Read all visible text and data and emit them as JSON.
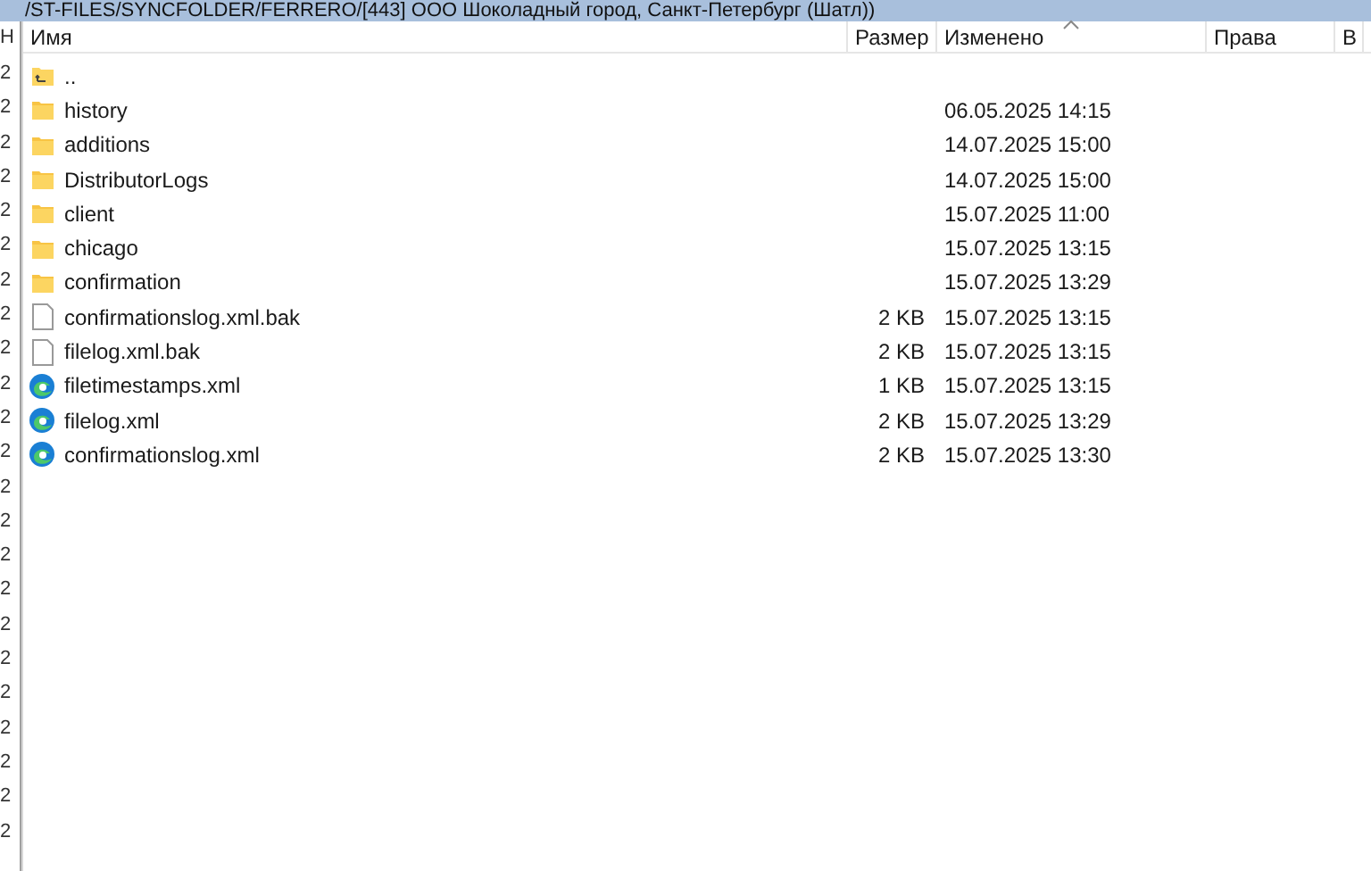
{
  "path_bar": {
    "title": "/ST-FILES/SYNCFOLDER/FERRERO/[443] ООО Шоколадный город, Санкт-Петербург (Шатл))"
  },
  "left_pane": {
    "header": "Н",
    "rows": [
      "2",
      "2",
      "2",
      "2",
      "2",
      "2",
      "2",
      "2",
      "2",
      "2",
      "2",
      "2",
      "2",
      "2",
      "2",
      "2",
      "2",
      "2",
      "2",
      "2",
      "2",
      "2",
      "2"
    ]
  },
  "table": {
    "columns": [
      {
        "label": "Имя",
        "sorted": false
      },
      {
        "label": "Размер",
        "sorted": false
      },
      {
        "label": "Изменено",
        "sorted": true
      },
      {
        "label": "Права",
        "sorted": false
      },
      {
        "label": "В",
        "sorted": false
      }
    ],
    "rows": [
      {
        "kind": "parent",
        "name": "..",
        "size": "",
        "modified": ""
      },
      {
        "kind": "folder",
        "name": "history",
        "size": "",
        "modified": "06.05.2025 14:15"
      },
      {
        "kind": "folder",
        "name": "additions",
        "size": "",
        "modified": "14.07.2025 15:00"
      },
      {
        "kind": "folder",
        "name": "DistributorLogs",
        "size": "",
        "modified": "14.07.2025 15:00"
      },
      {
        "kind": "folder",
        "name": "client",
        "size": "",
        "modified": "15.07.2025 11:00"
      },
      {
        "kind": "folder",
        "name": "chicago",
        "size": "",
        "modified": "15.07.2025 13:15"
      },
      {
        "kind": "folder",
        "name": "confirmation",
        "size": "",
        "modified": "15.07.2025 13:29"
      },
      {
        "kind": "file",
        "name": "confirmationslog.xml.bak",
        "size": "2 KB",
        "modified": "15.07.2025 13:15"
      },
      {
        "kind": "file",
        "name": "filelog.xml.bak",
        "size": "2 KB",
        "modified": "15.07.2025 13:15"
      },
      {
        "kind": "xml",
        "name": "filetimestamps.xml",
        "size": "1 KB",
        "modified": "15.07.2025 13:15"
      },
      {
        "kind": "xml",
        "name": "filelog.xml",
        "size": "2 KB",
        "modified": "15.07.2025 13:29"
      },
      {
        "kind": "xml",
        "name": "confirmationslog.xml",
        "size": "2 KB",
        "modified": "15.07.2025 13:30"
      }
    ]
  }
}
